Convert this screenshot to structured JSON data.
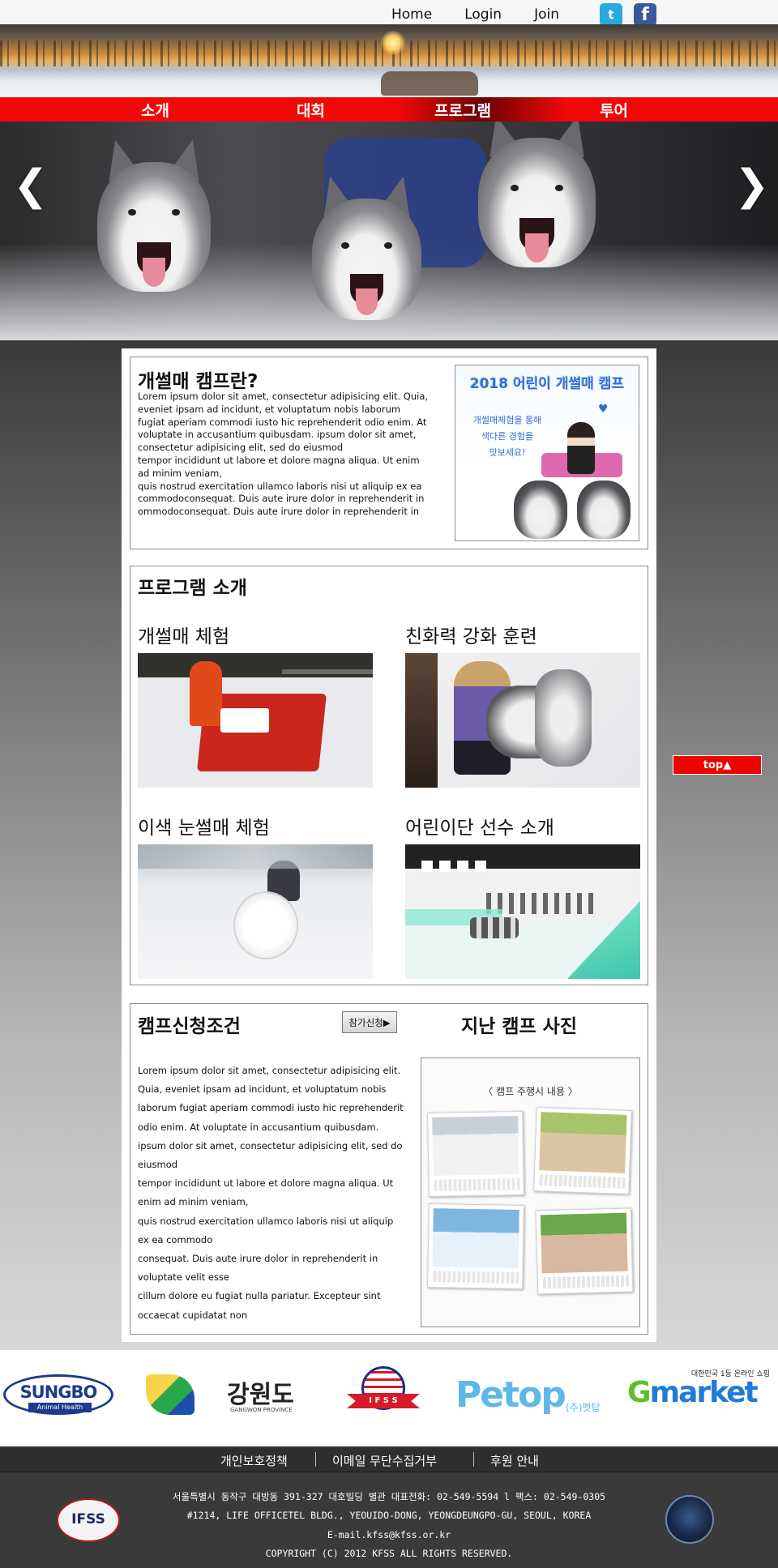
{
  "topbar": {
    "links": [
      "Home",
      "Login",
      "Join"
    ],
    "social": [
      "twitter-icon",
      "facebook-icon"
    ]
  },
  "nav": {
    "items": [
      "소개",
      "대회",
      "프로그램",
      "투어"
    ],
    "active_index": 2
  },
  "hero": {
    "prev_label": "❮",
    "next_label": "❯"
  },
  "intro": {
    "title": "개썰매 캠프란?",
    "body": "Lorem ipsum dolor sit amet, consectetur adipisicing elit. Quia, eveniet ipsam ad incidunt, et voluptatum nobis laborum fugiat aperiam commodi iusto hic reprehenderit odio enim. At voluptate in accusantium quibusdam. ipsum dolor sit amet, consectetur adipisicing elit, sed do eiusmod\ntempor incididunt ut labore et dolore magna aliqua. Ut enim ad minim veniam,\nquis nostrud exercitation ullamco laboris nisi ut aliquip ex ea commodoconsequat. Duis aute irure dolor in reprehenderit in ommodoconsequat. Duis aute irure dolor in reprehenderit in",
    "poster": {
      "title": "2018 어린이 개썰매 캠프",
      "text": "개썰매체험을 통해\n색다른 경험을\n맛보세요!"
    }
  },
  "program": {
    "title": "프로그램 소개",
    "items": [
      {
        "label": "개썰매 체험"
      },
      {
        "label": "친화력 강화 훈련"
      },
      {
        "label": "이색 눈썰매 체험"
      },
      {
        "label": "어린이단 선수 소개"
      }
    ]
  },
  "camp": {
    "title": "캠프신청조건",
    "apply_label": "참가신청▶",
    "past_title": "지난 캠프 사진",
    "past_caption": "〈 캠프 주행시 내용 〉",
    "body": "Lorem ipsum dolor sit amet, consectetur adipisicing elit. Quia, eveniet ipsam ad incidunt, et voluptatum nobis laborum fugiat aperiam commodi iusto hic reprehenderit odio enim. At voluptate in accusantium quibusdam.\nipsum dolor sit amet, consectetur adipisicing elit, sed do eiusmod\ntempor incididunt ut labore et dolore magna aliqua. Ut enim ad minim veniam,\nquis nostrud exercitation ullamco laboris nisi ut aliquip ex ea commodo\nconsequat. Duis aute irure dolor in reprehenderit in voluptate velit esse\ncillum dolore eu fugiat nulla pariatur. Excepteur sint occaecat cupidatat non"
  },
  "top_button": "top▲",
  "sponsors": {
    "sungbo": {
      "name": "SUNGBO",
      "sub": "Animal Health"
    },
    "gangwon": {
      "name": "강원도",
      "sub": "GANGWON PROVINCE"
    },
    "ifss": {
      "name": "I F S S"
    },
    "petop": {
      "name": "Petop",
      "sub": "(주)펫탑"
    },
    "gmarket": {
      "tag": "대한민국 1등 온라인 쇼핑",
      "g": "G",
      "rest": "market"
    }
  },
  "footer": {
    "links": [
      "개인보호정책",
      "이메일 무단수집거부",
      "후원 안내"
    ],
    "address_kr": "서울특별시 동작구 대방동 391-327 대호빌딩 별관 대표전화: 02-549-5594 l 팩스: 02-549-0305",
    "address_en": "#1214, LIFE OFFICETEL BLDG., YEOUIDO-DONG, YEONGDEUNGPO-GU, SEOUL, KOREA",
    "email": "E-mail.kfss@kfss.or.kr",
    "copyright": "COPYRIGHT (C) 2012 KFSS ALL RIGHTS RESERVED.",
    "logo_left": "IFSS"
  },
  "colors": {
    "nav_red": "#f20808",
    "top_button": "#f00000",
    "footer_bg": "#3a3a3a"
  }
}
